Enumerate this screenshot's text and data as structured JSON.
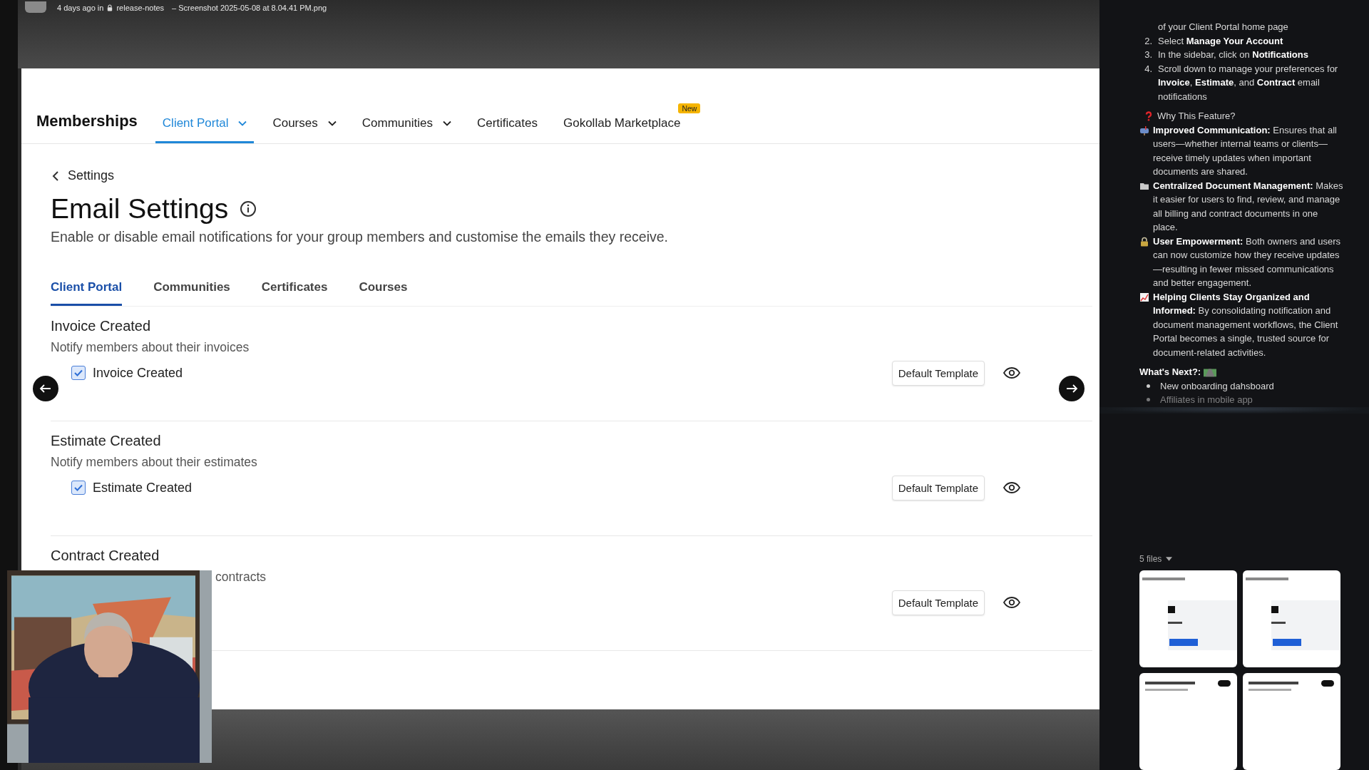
{
  "top_bar": {
    "meta": "4 days ago in",
    "channel": "release-notes",
    "file": "– Screenshot 2025-05-08 at 8.04.41 PM.png"
  },
  "nav": {
    "brand": "Memberships",
    "items": [
      {
        "label": "Client Portal",
        "dropdown": true,
        "selected": true
      },
      {
        "label": "Courses",
        "dropdown": true,
        "selected": false
      },
      {
        "label": "Communities",
        "dropdown": true,
        "selected": false
      },
      {
        "label": "Certificates",
        "dropdown": false,
        "selected": false
      },
      {
        "label": "Gokollab Marketplace",
        "dropdown": false,
        "selected": false,
        "badge": "New"
      }
    ]
  },
  "back": "Settings",
  "title": "Email Settings",
  "description": "Enable or disable email notifications for your group members and customise the emails they receive.",
  "tabs": [
    {
      "label": "Client Portal",
      "selected": true
    },
    {
      "label": "Communities",
      "selected": false
    },
    {
      "label": "Certificates",
      "selected": false
    },
    {
      "label": "Courses",
      "selected": false
    }
  ],
  "sections": [
    {
      "title": "Invoice Created",
      "description": "Notify members about their invoices",
      "option": {
        "label": "Invoice Created",
        "checked": true
      },
      "template": "Default Template"
    },
    {
      "title": "Estimate Created",
      "description": "Notify members about their estimates",
      "option": {
        "label": "Estimate Created",
        "checked": true
      },
      "template": "Default Template"
    },
    {
      "title": "Contract Created",
      "description": "contracts",
      "template": "Default Template"
    }
  ],
  "thread": {
    "steps": [
      {
        "text": "of your Client Portal home page"
      },
      {
        "number": "2.",
        "text": "Select **Manage Your Account**"
      },
      {
        "number": "3.",
        "text": "In the sidebar, click on **Notifications**"
      },
      {
        "number": "4.",
        "text": "Scroll down to manage your preferences for **Invoice**, **Estimate**, and **Contract** email notifications"
      }
    ],
    "paragraphs": [
      {
        "kind": "question",
        "text": "Why This Feature?"
      },
      {
        "kind": "mailbox",
        "text": "**Improved Communication:** Ensures that all users—whether internal teams or clients—receive timely updates when important documents are shared."
      },
      {
        "kind": "folder",
        "text": "**Centralized Document Management:** Makes it easier for users to find, review, and manage all billing and contract documents in one place."
      },
      {
        "kind": "lock",
        "text": "**User Empowerment:** Both owners and users can now customize how they receive updates—resulting in fewer missed communications and better engagement."
      },
      {
        "kind": "chart",
        "text": "**Helping Clients Stay Organized and Informed:** By consolidating notification and document management workflows, the Client Portal becomes a single, trusted source for document-related activities."
      }
    ],
    "next_heading": "What's Next?:",
    "next_items": [
      {
        "text": "New onboarding dahsboard",
        "faded": false
      },
      {
        "text": "Affiliates in mobile app",
        "faded": true
      }
    ],
    "files": {
      "label": "5 files",
      "thumbnails": [
        {
          "kind": "email"
        },
        {
          "kind": "email"
        },
        {
          "kind": "settings"
        },
        {
          "kind": "settings"
        }
      ]
    }
  }
}
